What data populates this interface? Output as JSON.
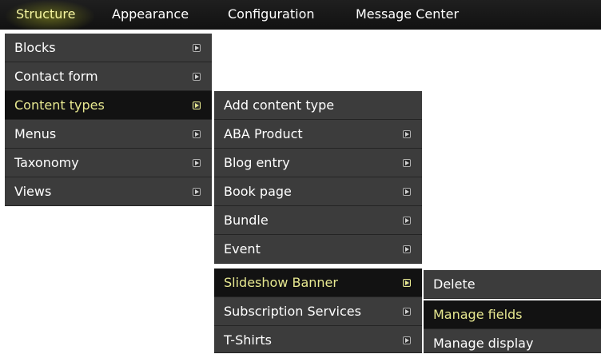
{
  "menubar": {
    "items": [
      {
        "label": "Structure"
      },
      {
        "label": "Appearance"
      },
      {
        "label": "Configuration"
      },
      {
        "label": "Message Center"
      }
    ]
  },
  "structure_menu": {
    "items": [
      {
        "label": "Blocks"
      },
      {
        "label": "Contact form"
      },
      {
        "label": "Content types"
      },
      {
        "label": "Menus"
      },
      {
        "label": "Taxonomy"
      },
      {
        "label": "Views"
      }
    ]
  },
  "content_types_menu": {
    "items": [
      {
        "label": "Add content type"
      },
      {
        "label": "ABA Product"
      },
      {
        "label": "Blog entry"
      },
      {
        "label": "Book page"
      },
      {
        "label": "Bundle"
      },
      {
        "label": "Event"
      },
      {
        "label": "Slideshow Banner"
      },
      {
        "label": "Subscription Services"
      },
      {
        "label": "T-Shirts"
      }
    ]
  },
  "slideshow_menu": {
    "items": [
      {
        "label": "Delete"
      },
      {
        "label": "Manage fields"
      },
      {
        "label": "Manage display"
      }
    ]
  },
  "colors": {
    "menu_bg": "#3c3c3c",
    "active_bg": "#121212",
    "active_text": "#e7e890",
    "topbar_bg": "#1a1a1a"
  },
  "icons": {
    "submenu_indicator": "submenu-arrow-icon"
  }
}
